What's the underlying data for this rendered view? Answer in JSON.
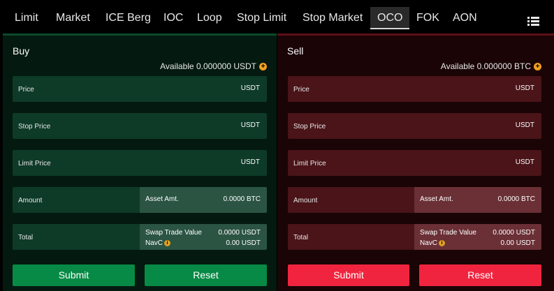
{
  "tabs": [
    "Limit",
    "Market",
    "ICE Berg",
    "IOC",
    "Loop",
    "Stop Limit",
    "Stop Market",
    "OCO",
    "FOK",
    "AON"
  ],
  "active_tab": "OCO",
  "buy": {
    "title": "Buy",
    "available": "Available 0.000000 USDT",
    "price_label": "Price",
    "price_unit": "USDT",
    "stop_price_label": "Stop Price",
    "stop_price_unit": "USDT",
    "limit_price_label": "Limit Price",
    "limit_price_unit": "USDT",
    "amount_label": "Amount",
    "asset_amt_label": "Asset Amt.",
    "asset_amt_value": "0.0000 BTC",
    "total_label": "Total",
    "swap_label": "Swap Trade Value",
    "swap_value": "0.0000 USDT",
    "navc_label": "NavC",
    "navc_value": "0.00 USDT",
    "submit_label": "Submit",
    "reset_label": "Reset"
  },
  "sell": {
    "title": "Sell",
    "available": "Available 0.000000 BTC",
    "price_label": "Price",
    "price_unit": "USDT",
    "stop_price_label": "Stop Price",
    "stop_price_unit": "USDT",
    "limit_price_label": "Limit Price",
    "limit_price_unit": "USDT",
    "amount_label": "Amount",
    "asset_amt_label": "Asset Amt.",
    "asset_amt_value": "0.0000 BTC",
    "total_label": "Total",
    "swap_label": "Swap Trade Value",
    "swap_value": "0.0000 USDT",
    "navc_label": "NavC",
    "navc_value": "0.00 USDT",
    "submit_label": "Submit",
    "reset_label": "Reset"
  },
  "colors": {
    "buy_accent": "#078a45",
    "sell_accent": "#f0243e"
  },
  "icons": {
    "menu": "list-menu-icon",
    "plus": "plus-circle-icon",
    "info": "info-icon"
  }
}
